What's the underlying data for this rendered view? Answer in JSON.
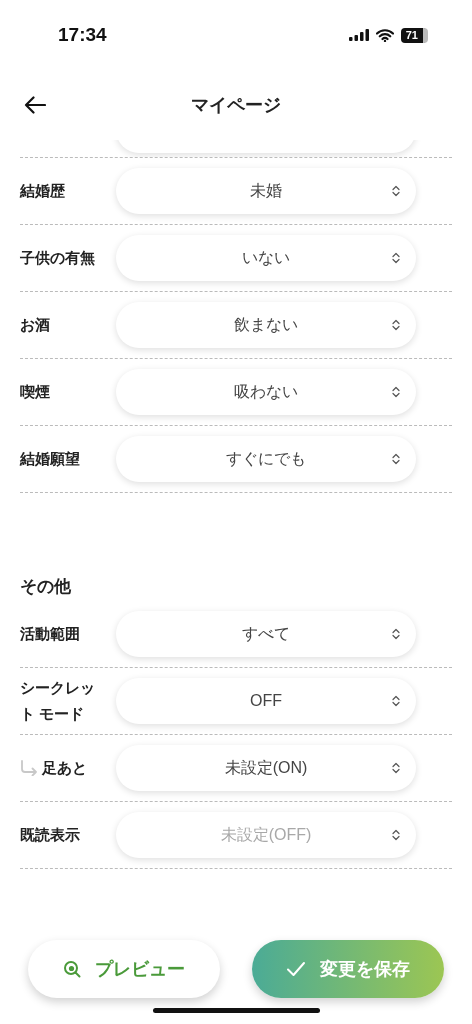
{
  "status_bar": {
    "time": "17:34",
    "battery": "71"
  },
  "header": {
    "title": "マイページ"
  },
  "sections": [
    {
      "rows": [
        {
          "label": "結婚歴",
          "value": "未婚",
          "kind": "field"
        },
        {
          "label": "子供の有無",
          "value": "いない",
          "kind": "field"
        },
        {
          "label": "お酒",
          "value": "飲まない",
          "kind": "field"
        },
        {
          "label": "喫煙",
          "value": "吸わない",
          "kind": "field"
        },
        {
          "label": "結婚願望",
          "value": "すぐにでも",
          "kind": "field"
        }
      ]
    },
    {
      "heading": "その他",
      "rows": [
        {
          "label": "活動範囲",
          "value": "すべて",
          "kind": "field"
        },
        {
          "label": "シークレット モード",
          "value": "OFF",
          "kind": "field"
        },
        {
          "label": "足あと",
          "value": "未設定(ON)",
          "kind": "sub"
        },
        {
          "label": "既読表示",
          "placeholder": "未設定(OFF)",
          "kind": "field"
        }
      ]
    }
  ],
  "buttons": {
    "preview": "プレビュー",
    "save": "変更を保存"
  }
}
